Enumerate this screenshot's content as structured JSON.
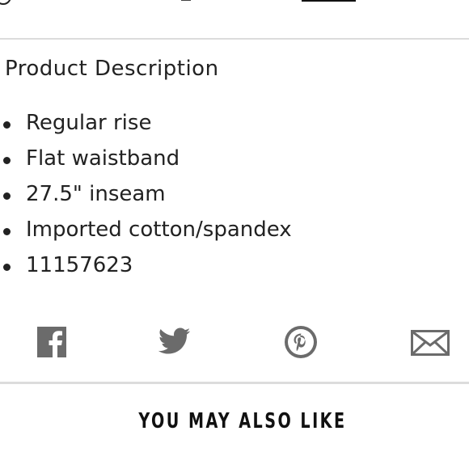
{
  "description": {
    "title": "Product Description",
    "items": [
      "Regular rise",
      "Flat waistband",
      "27.5\" inseam",
      "Imported cotton/spandex",
      "11157623"
    ]
  },
  "share": {
    "icons": [
      "facebook-icon",
      "twitter-icon",
      "pinterest-icon",
      "email-icon"
    ],
    "icon_color": "#6b6b6b"
  },
  "recommendations": {
    "heading": "YOU MAY ALSO LIKE"
  }
}
